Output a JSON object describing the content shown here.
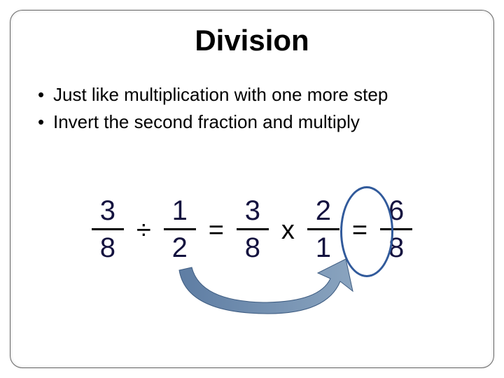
{
  "title": "Division",
  "bullets": [
    "Just like multiplication with one more step",
    "Invert the second fraction and multiply"
  ],
  "equation": {
    "f1": {
      "num": "3",
      "den": "8"
    },
    "op1": "÷",
    "f2": {
      "num": "1",
      "den": "2"
    },
    "op2": "=",
    "f3": {
      "num": "3",
      "den": "8"
    },
    "op3": "x",
    "f4": {
      "num": "2",
      "den": "1"
    },
    "op4": "=",
    "f5": {
      "num": "6",
      "den": "8"
    }
  }
}
